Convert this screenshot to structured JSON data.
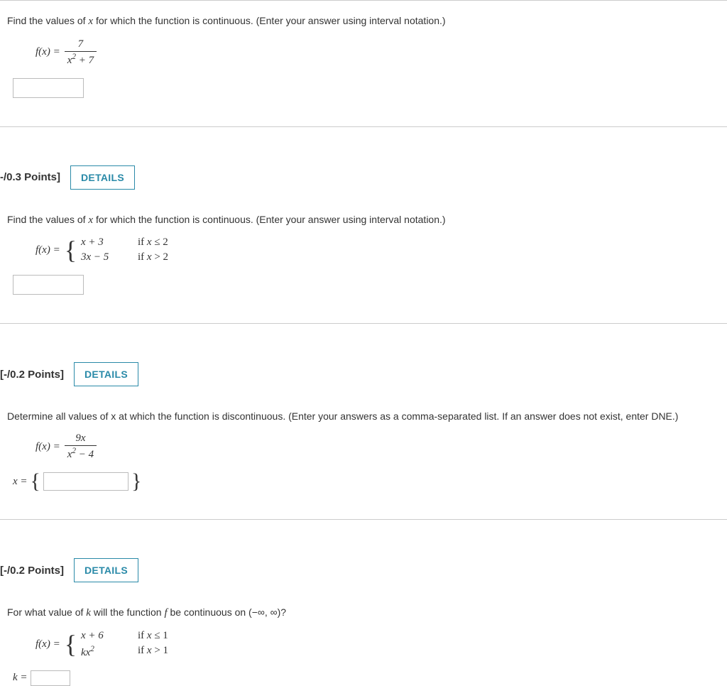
{
  "q1": {
    "prompt_a": "Find the values of ",
    "prompt_var": "x",
    "prompt_b": " for which the function is continuous. (Enter your answer using interval notation.)",
    "fx_label": "f(x) = ",
    "frac_num": "7",
    "frac_den_a": "x",
    "frac_den_b": " + 7"
  },
  "q2": {
    "points": "-/0.3 Points]",
    "details_label": "DETAILS",
    "prompt_a": "Find the values of ",
    "prompt_var": "x",
    "prompt_b": " for which the function is continuous. (Enter your answer using interval notation.)",
    "fx_label": "f(x) = ",
    "piece1_expr": "x + 3",
    "piece1_cond": "if x ≤ 2",
    "piece2_expr": "3x − 5",
    "piece2_cond": "if x > 2"
  },
  "q3": {
    "points": "[-/0.2 Points]",
    "details_label": "DETAILS",
    "prompt": "Determine all values of x at which the function is discontinuous. (Enter your answers as a comma-separated list. If an answer does not exist, enter DNE.)",
    "fx_label": "f(x) = ",
    "frac_num_a": "9",
    "frac_num_b": "x",
    "frac_den_a": "x",
    "frac_den_b": " − 4",
    "answer_prefix": "x = "
  },
  "q4": {
    "points": "[-/0.2 Points]",
    "details_label": "DETAILS",
    "prompt_a": "For what value of ",
    "prompt_k": "k",
    "prompt_b": " will the function ",
    "prompt_f": "f",
    "prompt_c": " be continuous on (−∞, ∞)?",
    "fx_label": "f(x) = ",
    "piece1_expr": "x + 6",
    "piece1_cond": "if x ≤ 1",
    "piece2_expr_a": "kx",
    "piece2_cond": "if x > 1",
    "answer_prefix": "k = "
  }
}
